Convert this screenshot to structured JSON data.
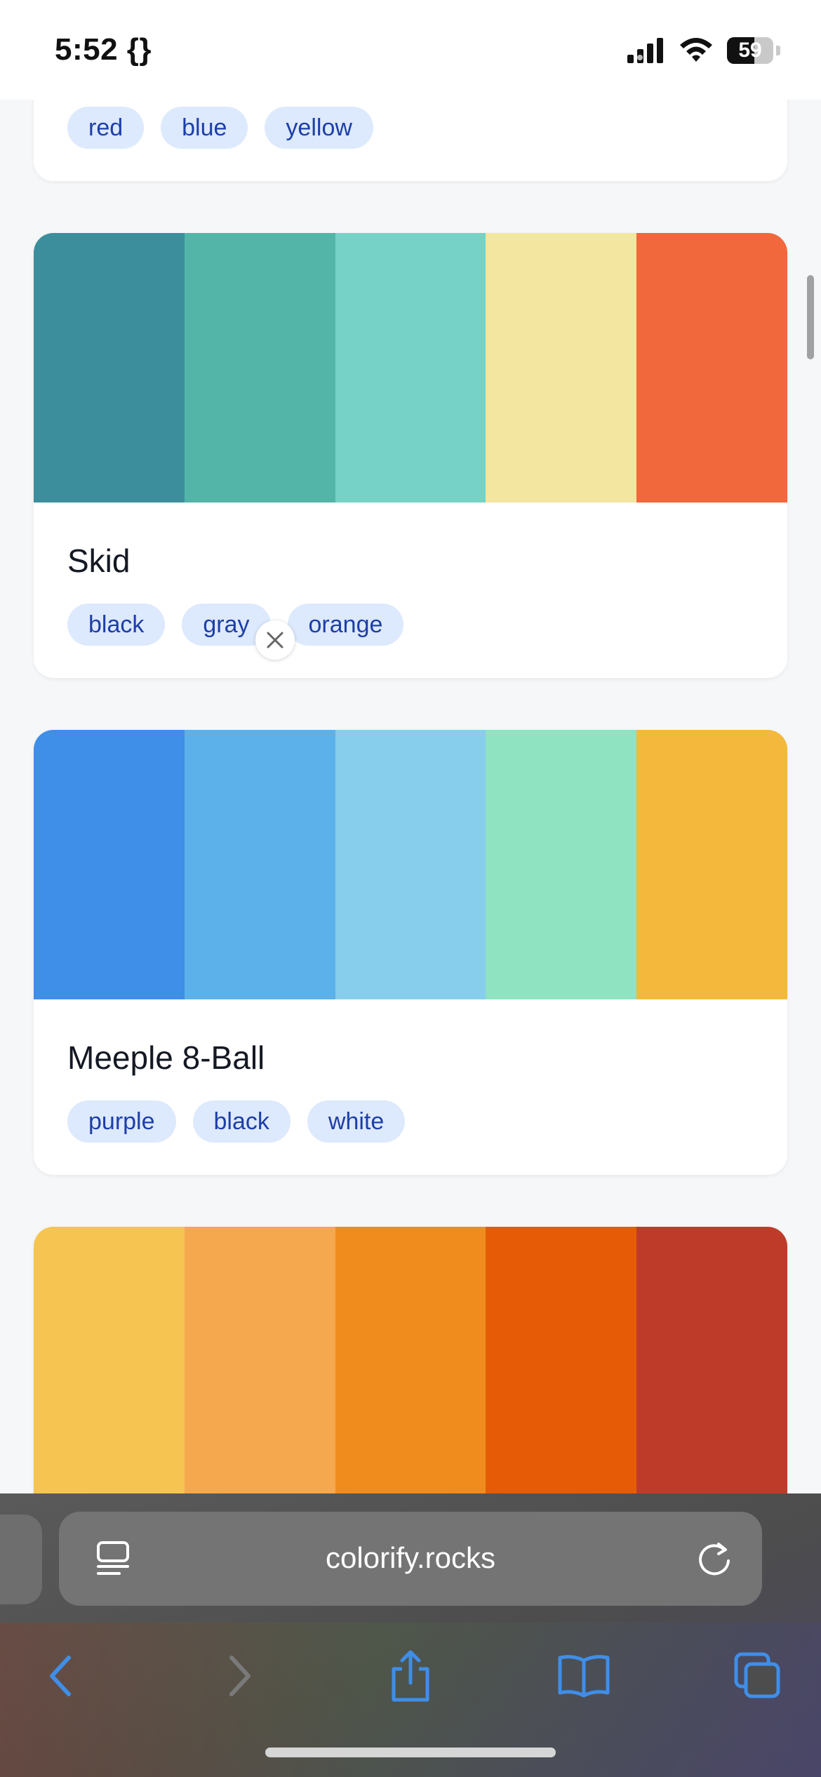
{
  "status_bar": {
    "time": "5:52 {}",
    "battery_level": "59",
    "battery_fraction": 0.59
  },
  "cards": [
    {
      "title": "",
      "tags": [
        "red",
        "blue",
        "yellow"
      ]
    },
    {
      "title": "Skid",
      "colors": [
        "#3d8e9d",
        "#52b5a8",
        "#76d2c6",
        "#f3e6a0",
        "#f0683b"
      ],
      "tags": [
        "black",
        "gray",
        "orange"
      ]
    },
    {
      "title": "Meeple 8-Ball",
      "colors": [
        "#3f8ee8",
        "#5cb1eb",
        "#86ceec",
        "#8fe3c1",
        "#f4b83d"
      ],
      "tags": [
        "purple",
        "black",
        "white"
      ]
    },
    {
      "title": "",
      "colors": [
        "#f6c451",
        "#f6a84f",
        "#f08c1e",
        "#e65c06",
        "#bf3b29"
      ]
    }
  ],
  "browser": {
    "url": "colorify.rocks",
    "accent": "#3f8ee8",
    "icons": {
      "reader": "reader-mode-icon",
      "reload": "reload-icon",
      "back": "back-icon",
      "forward": "forward-icon",
      "share": "share-icon",
      "bookmarks": "bookmarks-icon",
      "tabs": "tabs-icon"
    }
  }
}
